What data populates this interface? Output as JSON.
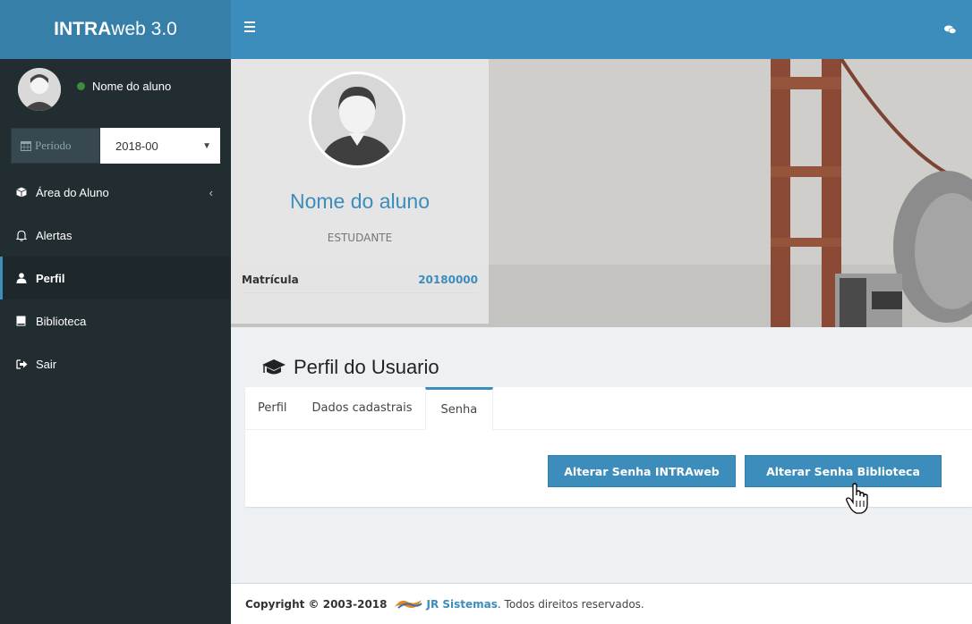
{
  "app": {
    "logo_bold": "INTRA",
    "logo_rest": "web 3.0"
  },
  "sidebar": {
    "user_name": "Nome do aluno",
    "period_label": "Período",
    "period_value": "2018-00",
    "items": [
      {
        "label": "Área do Aluno",
        "icon": "cube-icon"
      },
      {
        "label": "Alertas",
        "icon": "bell-icon"
      },
      {
        "label": "Perfil",
        "icon": "user-icon"
      },
      {
        "label": "Biblioteca",
        "icon": "book-icon"
      },
      {
        "label": "Sair",
        "icon": "sign-out-icon"
      }
    ]
  },
  "profile": {
    "name": "Nome do aluno",
    "role": "ESTUDANTE",
    "matricula_label": "Matrícula",
    "matricula_value": "20180000"
  },
  "main": {
    "section_title": "Perfil do Usuario",
    "tabs": [
      {
        "label": "Perfil"
      },
      {
        "label": "Dados cadastrais"
      },
      {
        "label": "Senha"
      }
    ],
    "buttons": {
      "change_intraweb": "Alterar Senha INTRAweb",
      "change_library": "Alterar Senha Biblioteca"
    }
  },
  "footer": {
    "copyright": "Copyright © 2003-2018",
    "brand": "JR Sistemas",
    "suffix": ". Todos direitos reservados."
  },
  "colors": {
    "accent": "#3c8dbc",
    "sidebar": "#222d32",
    "logo_bg": "#367fa9"
  }
}
